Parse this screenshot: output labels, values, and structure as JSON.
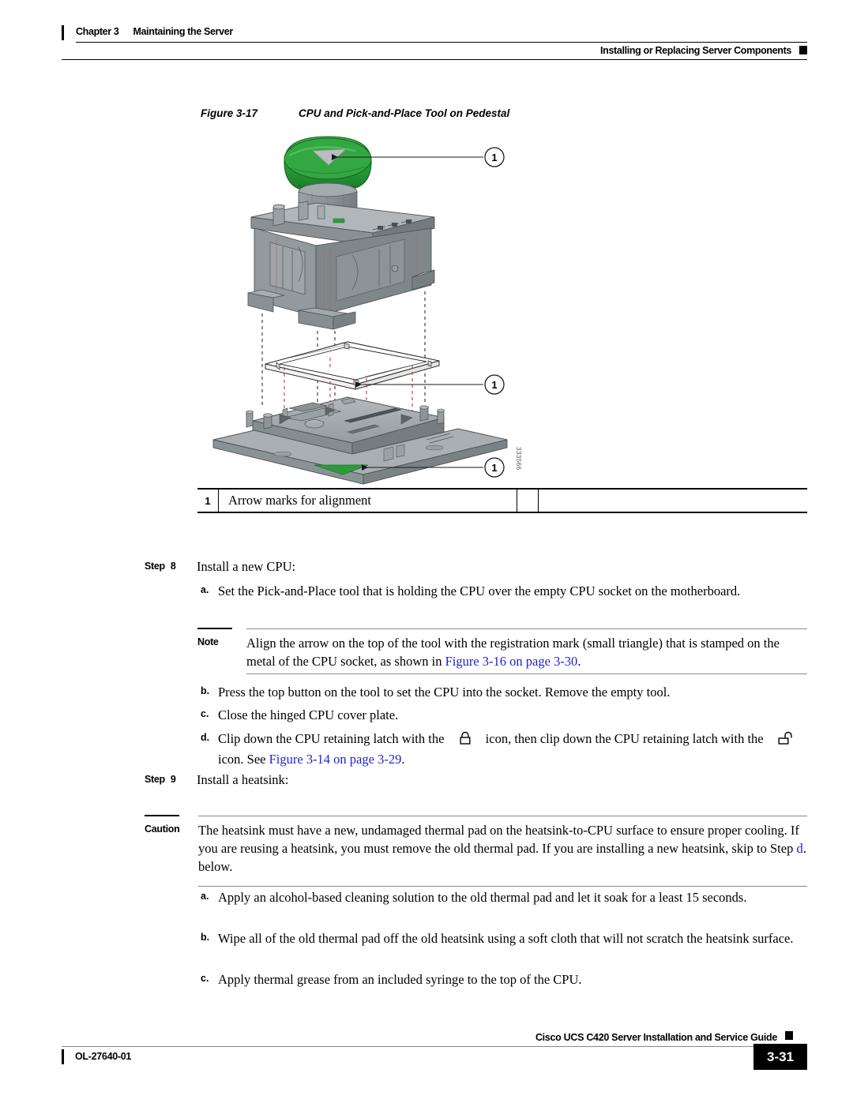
{
  "header": {
    "chapter": "Chapter 3",
    "chapter_title": "Maintaining the Server",
    "section": "Installing or Replacing Server Components"
  },
  "figure": {
    "number": "Figure 3-17",
    "title": "CPU and Pick-and-Place Tool on Pedestal",
    "figure_id": "333566",
    "callout_numbers": [
      "1",
      "1",
      "1"
    ],
    "legend": {
      "num": "1",
      "text": "Arrow marks for alignment"
    },
    "colors": {
      "tool_top_green": "#29a03a",
      "tool_top_green_dark": "#1d7d2b",
      "body_grey": "#8c9296",
      "body_grey_light": "#a8aeb2",
      "body_grey_dark": "#6f767a",
      "align_line_red": "#e8373c",
      "arrow_green": "#2e9b3b",
      "outline": "#2b2b2b"
    }
  },
  "steps": [
    {
      "label": "Step",
      "number": "8",
      "text": "Install a new CPU:"
    },
    {
      "label": "Step",
      "number": "9",
      "text": "Install a heatsink:"
    }
  ],
  "step8_substeps": [
    {
      "marker": "a.",
      "text": "Set the Pick-and-Place tool that is holding the CPU over the empty CPU socket on the motherboard."
    },
    {
      "marker": "b.",
      "text": "Press the top button on the tool to set the CPU into the socket. Remove the empty tool."
    },
    {
      "marker": "c.",
      "text": "Close the hinged CPU cover plate."
    }
  ],
  "step8_substep_d": {
    "marker": "d.",
    "text_part1": "Clip down the CPU retaining latch with the",
    "icon1": "closed-lock-icon",
    "text_part2": "icon, then clip down the CPU retaining latch with the",
    "icon2": "open-lock-icon",
    "text_part3": "icon. See",
    "link": "Figure 3-14 on page 3-29",
    "text_part4": "."
  },
  "note": {
    "label": "Note",
    "text_part1": "Align the arrow on the top of the tool with the registration mark (small triangle) that is stamped on the metal of the CPU socket, as shown in",
    "link": "Figure 3-16 on page 3-30",
    "text_part2": "."
  },
  "caution": {
    "label": "Caution",
    "text_part1": "The heatsink must have a new, undamaged thermal pad on the heatsink-to-CPU surface to ensure proper cooling. If you are reusing a heatsink, you must remove the old thermal pad. If you are installing a new heatsink, skip to Step",
    "link": "d",
    "text_part2": ". below."
  },
  "step9_substeps": [
    {
      "marker": "a.",
      "text": "Apply an alcohol-based cleaning solution to the old thermal pad and let it soak for a least 15 seconds."
    },
    {
      "marker": "b.",
      "text": "Wipe all of the old thermal pad off the old heatsink using a soft cloth that will not scratch the heatsink surface."
    },
    {
      "marker": "c.",
      "text": "Apply thermal grease from an included syringe to the top of the CPU."
    }
  ],
  "footer": {
    "guide_title": "Cisco UCS C420 Server Installation and Service Guide",
    "doc_id": "OL-27640-01",
    "page_number": "3-31"
  },
  "link_color": "#2222cc"
}
